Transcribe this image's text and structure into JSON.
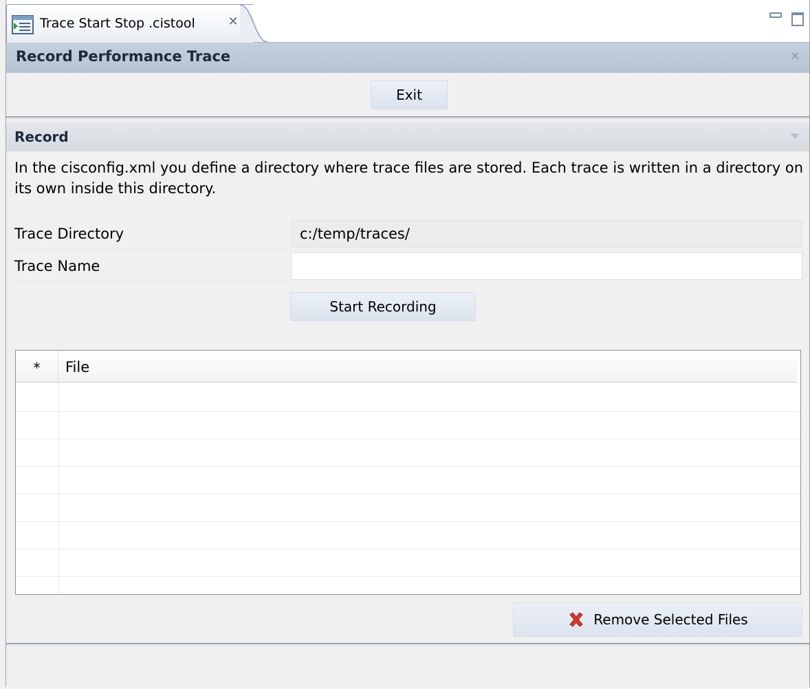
{
  "tab": {
    "label": "Trace Start Stop .cistool",
    "icon": "editor-file-icon"
  },
  "form": {
    "title": "Record Performance Trace",
    "exit_label": "Exit"
  },
  "section": {
    "title": "Record",
    "description": "In the cisconfig.xml you define a directory where trace files are stored. Each trace is written in a directory on its own inside this directory."
  },
  "fields": {
    "trace_directory_label": "Trace Directory",
    "trace_directory_value": "c:/temp/traces/",
    "trace_name_label": "Trace Name",
    "trace_name_value": ""
  },
  "actions": {
    "start_recording_label": "Start Recording",
    "remove_selected_label": "Remove Selected Files"
  },
  "table": {
    "columns": [
      "*",
      "File"
    ],
    "rows": []
  },
  "colors": {
    "header_bg": "#b6c3d3",
    "button_bg": "#dbe3ee",
    "remove_icon": "#d23b2f"
  }
}
